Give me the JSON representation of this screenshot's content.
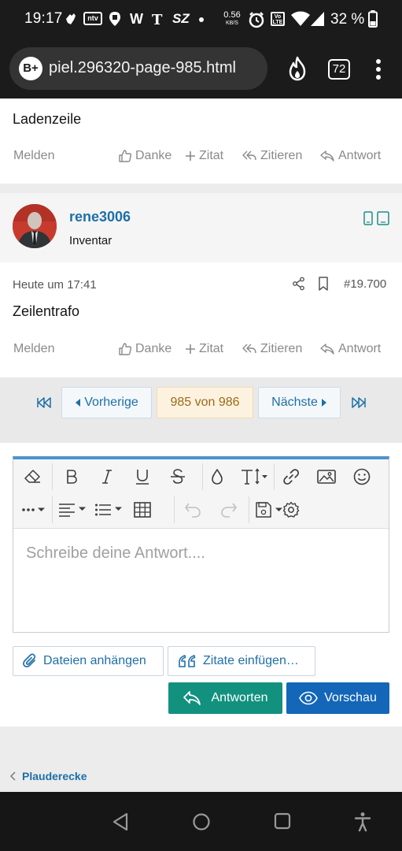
{
  "status_bar": {
    "time": "19:17",
    "net_speed_value": "0.56",
    "net_speed_unit": "KB/S",
    "battery": "32 %",
    "notification_icons": [
      "hand-icon",
      "ntv-icon",
      "location-icon",
      "w-icon",
      "nyt-icon",
      "sz-icon",
      "dot-icon"
    ],
    "sz_label": "SZ",
    "ntv_label": "ntv",
    "w_label": "W",
    "volte_label": "Vo LTE"
  },
  "browser": {
    "logo": "B+",
    "url": "piel.296320-page-985.html",
    "tab_count": "72"
  },
  "posts": [
    {
      "text": "Ladenzeile",
      "actions": {
        "report": "Melden",
        "like": "Danke",
        "quote": "Zitat",
        "reply_quote": "Zitieren",
        "reply": "Antwort"
      }
    },
    {
      "author": {
        "name": "rene3006",
        "title": "Inventar"
      },
      "time": "Heute um 17:41",
      "number": "#19.700",
      "text": "Zeilentrafo",
      "actions": {
        "report": "Melden",
        "like": "Danke",
        "quote": "Zitat",
        "reply_quote": "Zitieren",
        "reply": "Antwort"
      }
    }
  ],
  "pagination": {
    "prev": "Vorherige",
    "current": "985 von 986",
    "next": "Nächste"
  },
  "editor": {
    "placeholder": "Schreibe deine Antwort....",
    "toolbar_row1": [
      "eraser-icon",
      "bold-icon",
      "italic-icon",
      "underline-icon",
      "strikethrough-icon",
      "color-icon",
      "font-size-icon",
      "link-icon",
      "image-icon",
      "emoji-icon"
    ],
    "toolbar_row2": [
      "more-icon",
      "align-icon",
      "list-icon",
      "table-icon",
      "undo-icon",
      "redo-icon",
      "save-draft-icon",
      "settings-icon"
    ],
    "attach_label": "Dateien anhängen",
    "insert_quotes_label": "Zitate einfügen…",
    "reply_button": "Antworten",
    "preview_button": "Vorschau"
  },
  "breadcrumb": {
    "label": "Plauderecke"
  },
  "colors": {
    "accent": "#1e6fa8",
    "reply_button": "#12917f",
    "preview_button": "#1366b8",
    "editor_top_border": "#4b93cf"
  }
}
